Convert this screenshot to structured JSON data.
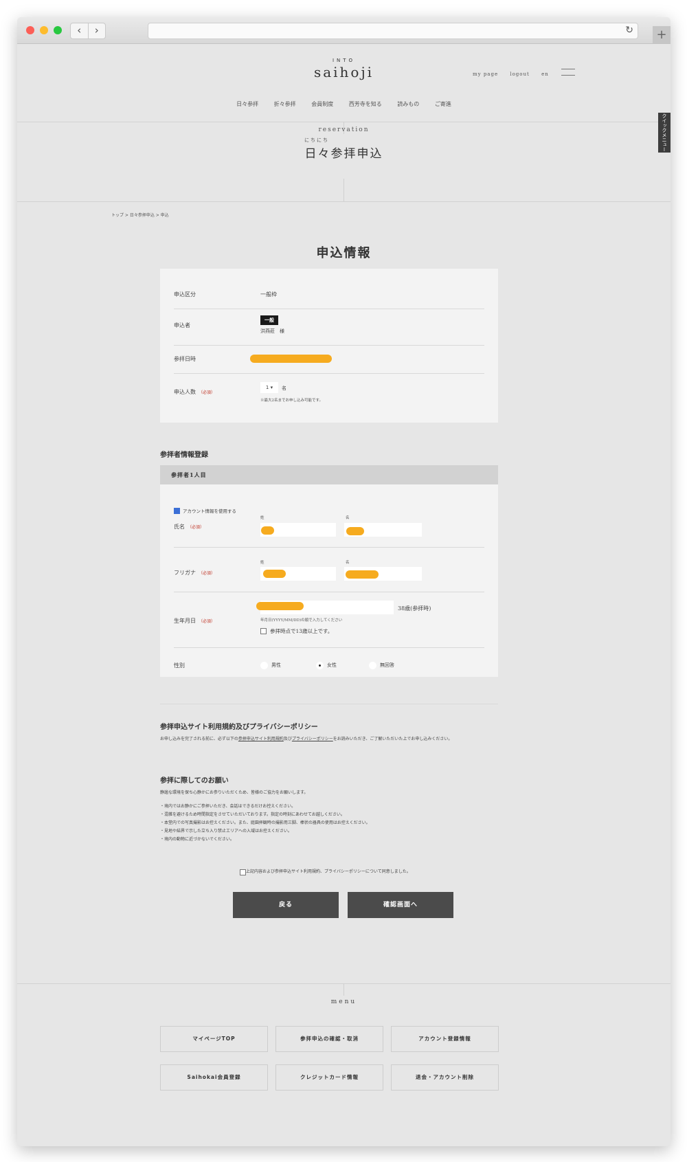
{
  "header": {
    "logo_small": "INTO",
    "logo": "saihoji",
    "links": [
      "my page",
      "logout",
      "en"
    ],
    "nav": [
      "日々参拝",
      "折々参拝",
      "会員制度",
      "西芳寺を知る",
      "読みもの",
      "ご寄進"
    ],
    "quick_menu": "クイックメニュー"
  },
  "hero": {
    "en": "reservation",
    "ruby": "にちにち",
    "title": "日々参拝申込"
  },
  "breadcrumb": "トップ > 日々参拝申込 > 申込",
  "application": {
    "title": "申込情報",
    "category_label": "申込区分",
    "category_value": "一般枠",
    "applicant_label": "申込者",
    "applicant_badge": "一般",
    "applicant_name": "洪燕莊　様",
    "datetime_label": "参拝日時",
    "count_label": "申込人数",
    "required": "（必須）",
    "count_value": "1 ▾",
    "count_unit": "名",
    "count_note": "※最大2名までお申し込み可能です。"
  },
  "visitor": {
    "section_title": "参拝者情報登録",
    "band_label": "参拝者1人目",
    "use_account": "アカウント情報を使用する",
    "name_label": "氏名",
    "furigana_label": "フリガナ",
    "sei": "姓",
    "mei": "名",
    "birth_label": "生年月日",
    "age": "38歳(参拝時)",
    "birth_note": "年月日(YYYY/MM/DD)の順で入力してください",
    "over13": "参拝時点で13歳以上です。",
    "gender_label": "性別",
    "gender_options": [
      "男性",
      "女性",
      "無回答"
    ],
    "gender_selected": "女性",
    "required": "（必須）"
  },
  "terms": {
    "title": "参拝申込サイト利用規約及びプライバシーポリシー",
    "text_before": "お申し込みを完了される前に、必ず以下の",
    "link1": "参拝申込サイト利用規約",
    "text_mid": "及び",
    "link2": "プライバシーポリシー",
    "text_after": "をお読みいただき、ご了解いただいた上でお申し込みください。"
  },
  "request": {
    "title": "参拝に際してのお願い",
    "intro": "静謐な環境を保ち心静かにお参りいただくため、皆様のご協力をお願いします。",
    "items": [
      "・境内ではお静かにご参拝いただき、会話はできるだけお控えください。",
      "・混雑を避けるため時間指定をさせていただいております。指定の時刻にあわせてお越しください。",
      "・本堂内での写真撮影はお控えください。また、庭園拝観時の撮影用三脚、棒状の器具の使用はお控えください。",
      "・見地や結界で示した立ち入り禁止エリアへの入域はお控えください。",
      "・境内の動物に近づかないでください。"
    ]
  },
  "agree": "上記内容および参拝申込サイト利用規約、プライバシーポリシーについて同意しました。",
  "buttons": {
    "back": "戻る",
    "confirm": "確認画面へ"
  },
  "menu": {
    "title": "menu",
    "items": [
      "マイページTOP",
      "参拝申込の確認・取消",
      "アカウント登録情報",
      "Saihokai会員登録",
      "クレジットカード情報",
      "退会・アカウント削除"
    ]
  },
  "colors": {
    "redaction": "#f6ab1f",
    "button": "#4b4b4b",
    "required": "#c0392b"
  }
}
